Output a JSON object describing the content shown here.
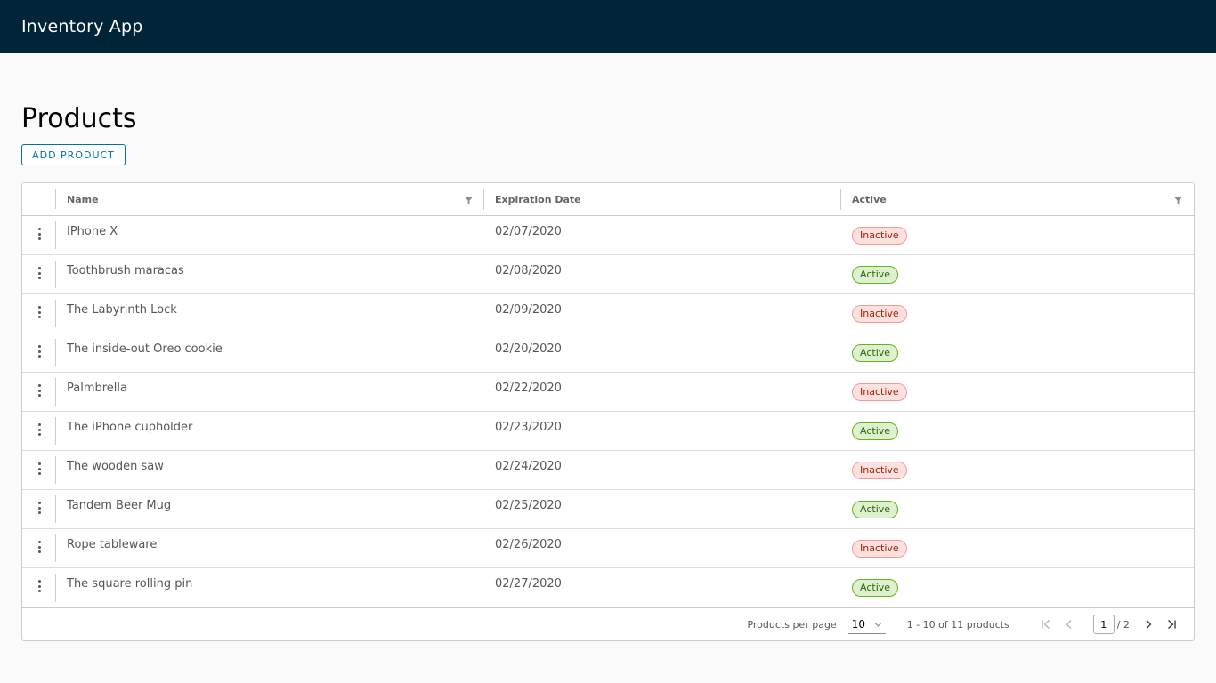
{
  "app": {
    "title": "Inventory App"
  },
  "page": {
    "title": "Products",
    "add_button": "ADD PRODUCT"
  },
  "grid": {
    "columns": {
      "name": "Name",
      "expiration": "Expiration Date",
      "active": "Active"
    },
    "rows": [
      {
        "name": "IPhone X",
        "date": "02/07/2020",
        "status": "Inactive"
      },
      {
        "name": "Toothbrush maracas",
        "date": "02/08/2020",
        "status": "Active"
      },
      {
        "name": "The Labyrinth Lock",
        "date": "02/09/2020",
        "status": "Inactive"
      },
      {
        "name": "The inside-out Oreo cookie",
        "date": "02/20/2020",
        "status": "Active"
      },
      {
        "name": "Palmbrella",
        "date": "02/22/2020",
        "status": "Inactive"
      },
      {
        "name": "The iPhone cupholder",
        "date": "02/23/2020",
        "status": "Active"
      },
      {
        "name": "The wooden saw",
        "date": "02/24/2020",
        "status": "Inactive"
      },
      {
        "name": "Tandem Beer Mug",
        "date": "02/25/2020",
        "status": "Active"
      },
      {
        "name": "Rope tableware",
        "date": "02/26/2020",
        "status": "Inactive"
      },
      {
        "name": "The square rolling pin",
        "date": "02/27/2020",
        "status": "Active"
      }
    ],
    "footer": {
      "per_page_label": "Products per page",
      "per_page_value": "10",
      "range": "1 - 10 of 11 products",
      "current_page": "1",
      "total_pages": "/ 2"
    }
  },
  "icons": {
    "filter": "filter-icon",
    "kebab": "vertical-ellipsis-icon",
    "first": "first-page-icon",
    "prev": "previous-page-icon",
    "next": "next-page-icon",
    "last": "last-page-icon",
    "dropdown": "chevron-down-icon"
  },
  "colors": {
    "header_bg": "#002538",
    "primary": "#0072a3",
    "inactive_bg": "#fde1e0",
    "inactive_border": "#f49a96",
    "active_bg": "#dff0d0",
    "active_border": "#5eb715"
  }
}
